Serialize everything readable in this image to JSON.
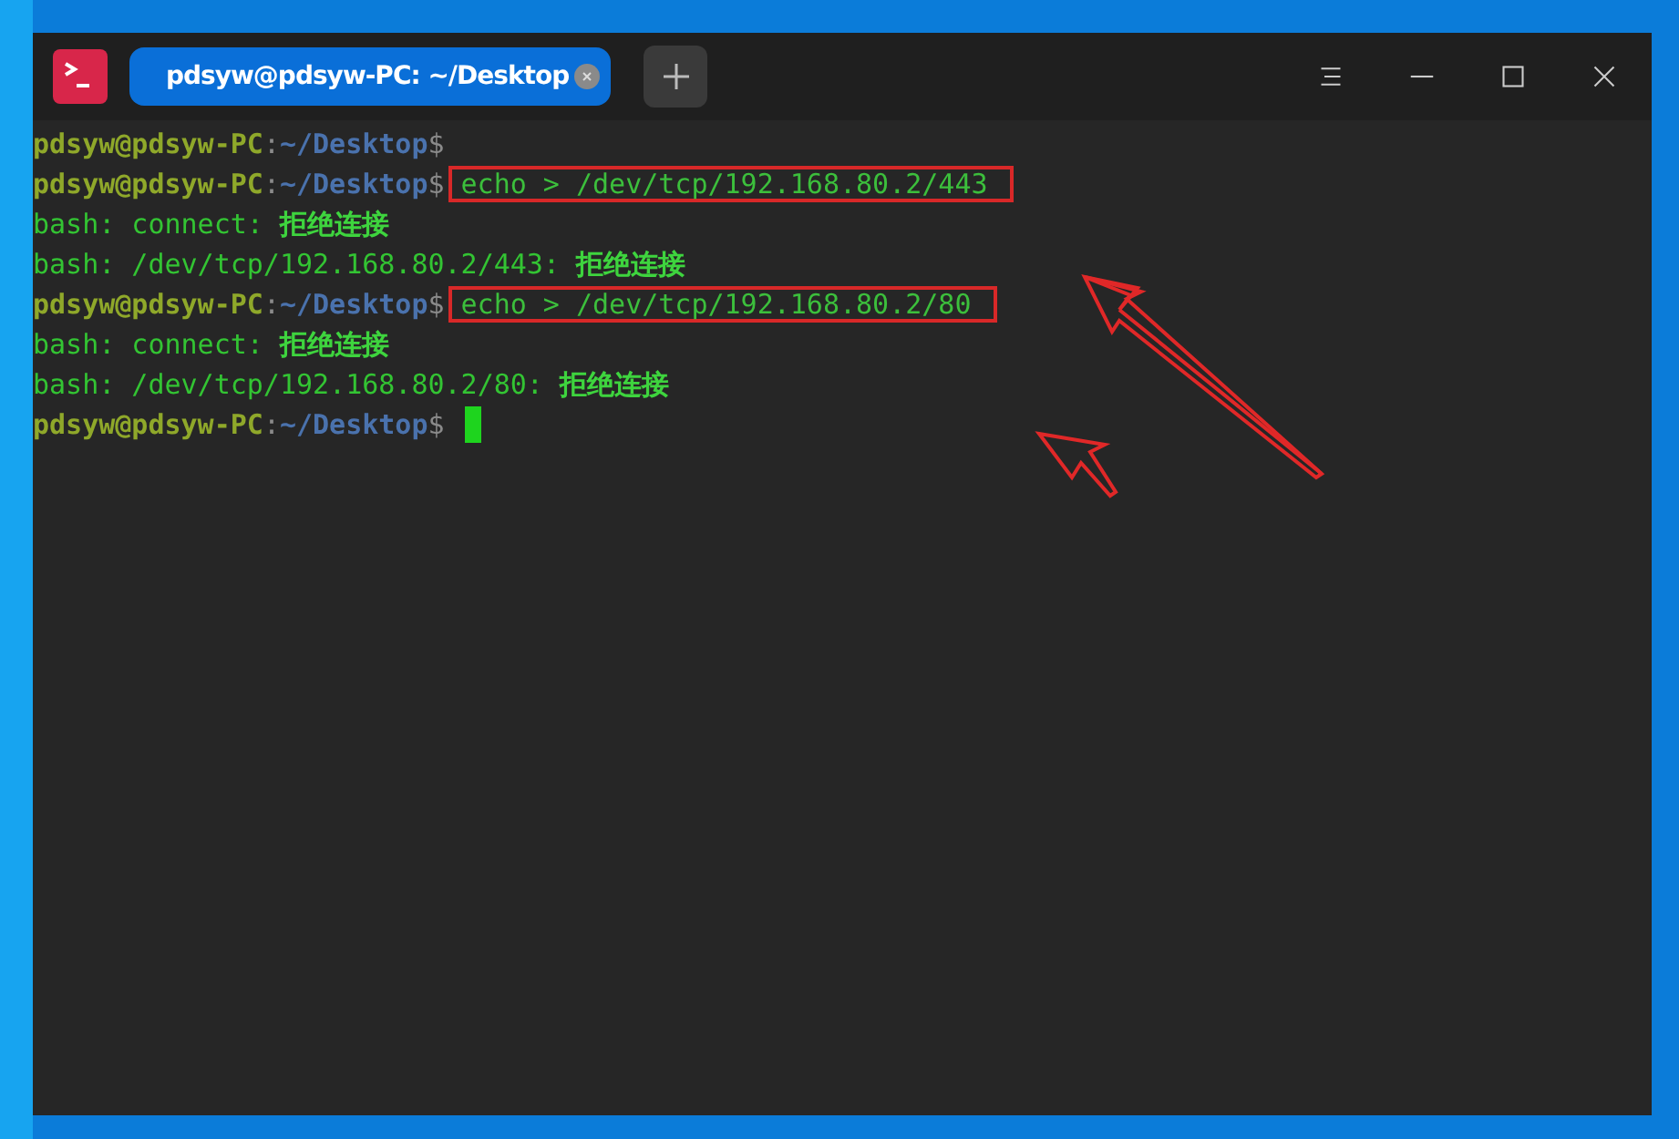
{
  "window": {
    "tabs": [
      {
        "title": "pdsyw@pdsyw-PC: ~/Desktop",
        "selected": true
      }
    ]
  },
  "terminal": {
    "lines": [
      {
        "kind": "prompt",
        "user": "pdsyw@pdsyw-PC",
        "sep": ":",
        "path": "~/Desktop",
        "sign": "$"
      },
      {
        "kind": "prompt",
        "user": "pdsyw@pdsyw-PC",
        "sep": ":",
        "path": "~/Desktop",
        "sign": "$",
        "command": "echo > /dev/tcp/192.168.80.2/443",
        "highlighted": true
      },
      {
        "kind": "output",
        "text": "bash: connect: **拒绝连接**"
      },
      {
        "kind": "output",
        "text": "bash: /dev/tcp/192.168.80.2/443: **拒绝连接**"
      },
      {
        "kind": "prompt",
        "user": "pdsyw@pdsyw-PC",
        "sep": ":",
        "path": "~/Desktop",
        "sign": "$",
        "command": "echo > /dev/tcp/192.168.80.2/80",
        "highlighted": true
      },
      {
        "kind": "output",
        "text": "bash: connect: **拒绝连接**"
      },
      {
        "kind": "output",
        "text": "bash: /dev/tcp/192.168.80.2/80: **拒绝连接**"
      },
      {
        "kind": "prompt",
        "user": "pdsyw@pdsyw-PC",
        "sep": ":",
        "path": "~/Desktop",
        "sign": "$",
        "cursor": true
      }
    ]
  }
}
